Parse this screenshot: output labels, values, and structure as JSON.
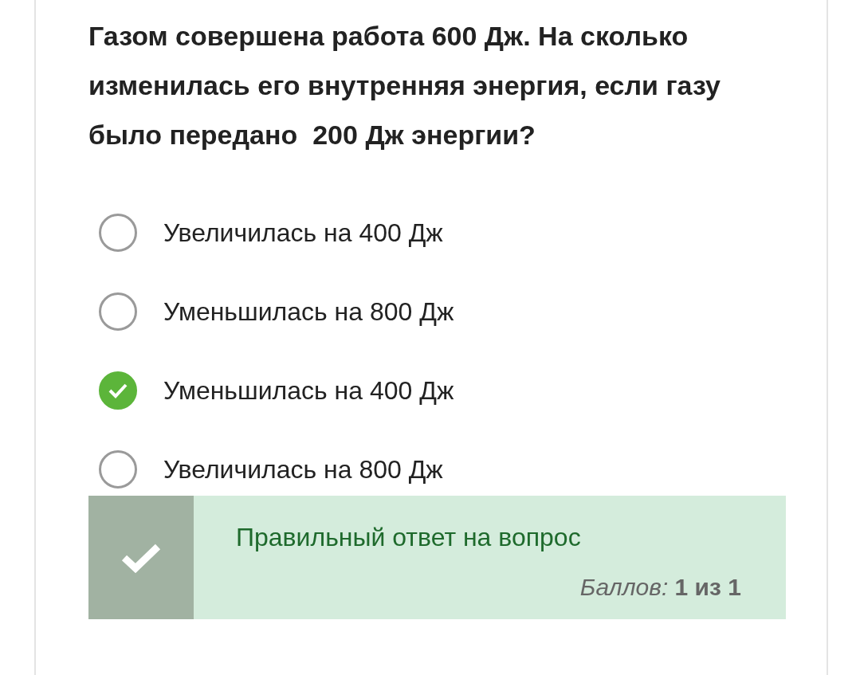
{
  "question": "Газом совершена работа 600 Дж. На сколько изменилась его внутренняя энергия, если газу было передано  200 Дж энергии?",
  "options": [
    {
      "label": "Увеличилась на 400 Дж",
      "selected": false
    },
    {
      "label": "Уменьшилась на 800 Дж",
      "selected": false
    },
    {
      "label": "Уменьшилась на 400 Дж",
      "selected": true
    },
    {
      "label": "Увеличилась на 800 Дж",
      "selected": false
    }
  ],
  "feedback": {
    "message": "Правильный ответ на вопрос",
    "score": "*Баллов:* **1 из 1**"
  }
}
